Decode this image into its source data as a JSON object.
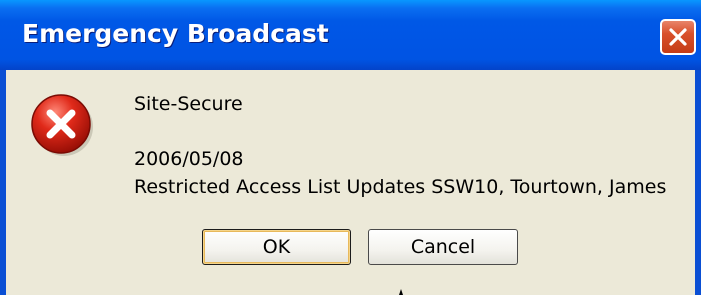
{
  "window": {
    "title": "Emergency Broadcast",
    "close_icon": "close-icon",
    "titlebar_color": "#0054e3"
  },
  "message": {
    "icon": "error-icon",
    "line1": "Site-Secure",
    "line2": "2006/05/08",
    "line3": "Restricted Access List Updates SSW10, Tourtown, James"
  },
  "buttons": {
    "ok_label": "OK",
    "cancel_label": "Cancel"
  }
}
